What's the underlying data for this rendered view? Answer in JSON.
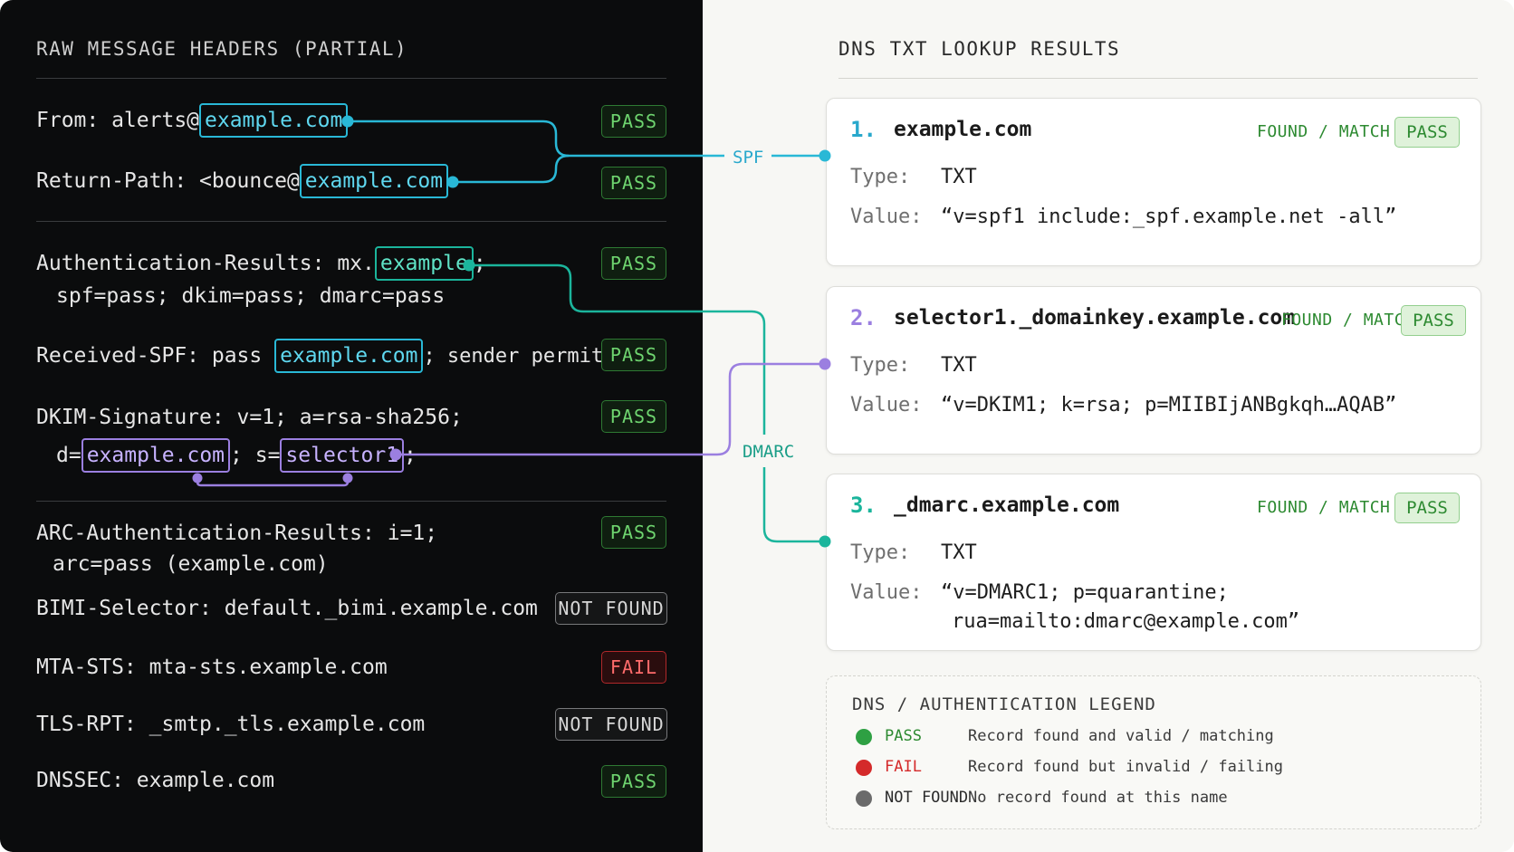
{
  "left_panel": {
    "title": "RAW MESSAGE HEADERS (PARTIAL)",
    "rows": {
      "from": {
        "label": "From: alerts@",
        "domain": "example.com",
        "status": "PASS"
      },
      "return_path": {
        "label": "Return-Path: <bounce@",
        "domain": "example.com",
        "status": "PASS"
      },
      "auth_results": {
        "label": "Authentication-Results: mx.",
        "domain": "example",
        "suffix": ";",
        "line2": "spf=pass; dkim=pass; dmarc=pass",
        "status": "PASS"
      },
      "received_spf": {
        "label": "Received-SPF: pass ",
        "domain": "example.com",
        "suffix": "; sender permitted)",
        "status": "PASS"
      },
      "dkim": {
        "line1": "DKIM-Signature: v=1; a=rsa-sha256;",
        "prefix": "d=",
        "domain": "example.com",
        "mid": "; s=",
        "selector": "selector1",
        "suffix": ";",
        "status": "PASS"
      },
      "arc": {
        "line1": "ARC-Authentication-Results: i=1;",
        "line2": "arc=pass (example.com)",
        "status": "PASS"
      },
      "bimi": {
        "text": "BIMI-Selector: default._bimi.example.com",
        "status": "NOT FOUND"
      },
      "mta_sts": {
        "text": "MTA-STS:  mta-sts.example.com",
        "status": "FAIL"
      },
      "tls_rpt": {
        "text": "TLS-RPT:  _smtp._tls.example.com",
        "status": "NOT FOUND"
      },
      "dnssec": {
        "text": "DNSSEC:  example.com",
        "status": "PASS"
      }
    }
  },
  "connectors": {
    "spf_label": "SPF",
    "dmarc_label": "DMARC"
  },
  "right_panel": {
    "title": "DNS TXT LOOKUP RESULTS",
    "results": [
      {
        "num": "1.",
        "domain": "example.com",
        "found": "FOUND / MATCH",
        "status": "PASS",
        "type_label": "Type:",
        "type": "TXT",
        "value_label": "Value:",
        "value": "“v=spf1 include:_spf.example.net -all”",
        "value2": ""
      },
      {
        "num": "2.",
        "domain": "selector1._domainkey.example.com",
        "found": "FOUND / MATCH",
        "status": "PASS",
        "type_label": "Type:",
        "type": "TXT",
        "value_label": "Value:",
        "value": "“v=DKIM1; k=rsa; p=MIIBIjANBgkqh…AQAB”",
        "value2": ""
      },
      {
        "num": "3.",
        "domain": "_dmarc.example.com",
        "found": "FOUND / MATCH",
        "status": "PASS",
        "type_label": "Type:",
        "type": "TXT",
        "value_label": "Value:",
        "value": "“v=DMARC1; p=quarantine;",
        "value2": "rua=mailto:dmarc@example.com”"
      }
    ],
    "legend": {
      "title": "DNS / AUTHENTICATION LEGEND",
      "items": [
        {
          "key": "PASS",
          "desc": "Record found and valid / matching",
          "color": "#2ea043"
        },
        {
          "key": "FAIL",
          "desc": "Record found but invalid / failing",
          "color": "#d42a2a"
        },
        {
          "key": "NOT FOUND",
          "desc": "No record found at this name",
          "color": "#6b6b6b"
        }
      ]
    }
  },
  "colors": {
    "spf": "#29b8d6",
    "dmarc": "#1bb59c",
    "dkim": "#9b7fe0",
    "pass": "#2e7a33",
    "fail": "#b0282a"
  }
}
